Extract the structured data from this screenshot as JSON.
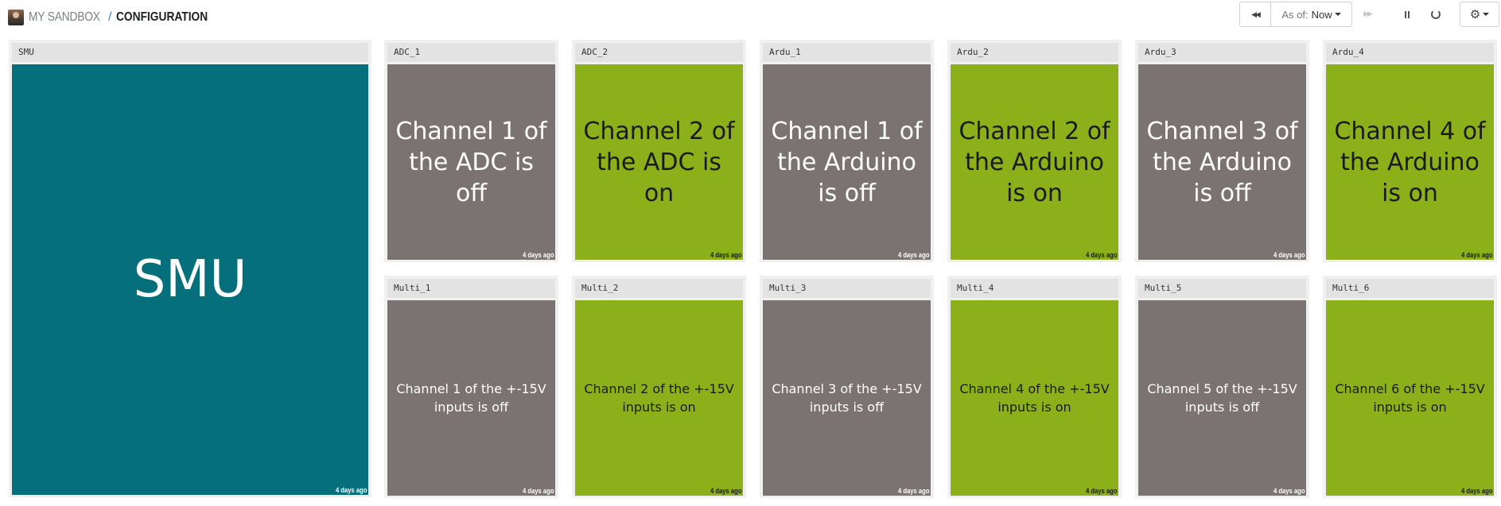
{
  "breadcrumb": {
    "parent": "MY SANDBOX",
    "separator": "/",
    "current": "CONFIGURATION"
  },
  "toolbar": {
    "rewind_icon": "rewind-icon",
    "as_of_label": "As of:",
    "as_of_value": "Now",
    "fast_forward_icon": "fast-forward-icon",
    "pause_icon": "pause-icon",
    "refresh_icon": "refresh-icon",
    "settings_icon": "gear-icon"
  },
  "colors": {
    "off": "#7a7371",
    "on": "#8cb019",
    "smu": "#066f7c"
  },
  "tiles": {
    "smu": {
      "title": "SMU",
      "text": "SMU",
      "time": "4 days ago"
    },
    "adc_1": {
      "title": "ADC_1",
      "text": "Channel 1 of the ADC is off",
      "time": "4 days ago",
      "state": "off"
    },
    "adc_2": {
      "title": "ADC_2",
      "text": "Channel 2 of the ADC is on",
      "time": "4 days ago",
      "state": "on"
    },
    "ardu_1": {
      "title": "Ardu_1",
      "text": "Channel 1 of the Arduino is off",
      "time": "4 days ago",
      "state": "off"
    },
    "ardu_2": {
      "title": "Ardu_2",
      "text": "Channel 2 of the Arduino is on",
      "time": "4 days ago",
      "state": "on"
    },
    "ardu_3": {
      "title": "Ardu_3",
      "text": "Channel 3 of the Arduino is off",
      "time": "4 days ago",
      "state": "off"
    },
    "ardu_4": {
      "title": "Ardu_4",
      "text": "Channel 4 of the Arduino is on",
      "time": "4 days ago",
      "state": "on"
    },
    "multi_1": {
      "title": "Multi_1",
      "text": "Channel 1 of the +-15V inputs is off",
      "time": "4 days ago",
      "state": "off"
    },
    "multi_2": {
      "title": "Multi_2",
      "text": "Channel 2 of the +-15V inputs is on",
      "time": "4 days ago",
      "state": "on"
    },
    "multi_3": {
      "title": "Multi_3",
      "text": "Channel 3 of the +-15V inputs is off",
      "time": "4 days ago",
      "state": "off"
    },
    "multi_4": {
      "title": "Multi_4",
      "text": "Channel 4 of the +-15V inputs is on",
      "time": "4 days ago",
      "state": "on"
    },
    "multi_5": {
      "title": "Multi_5",
      "text": "Channel 5 of the +-15V inputs is off",
      "time": "4 days ago",
      "state": "off"
    },
    "multi_6": {
      "title": "Multi_6",
      "text": "Channel 6 of the +-15V inputs is on",
      "time": "4 days ago",
      "state": "on"
    }
  }
}
